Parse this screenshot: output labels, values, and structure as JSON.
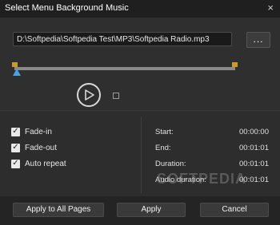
{
  "window": {
    "title": "Select Menu Background Music",
    "close_glyph": "×"
  },
  "file": {
    "path": "D:\\Softpedia\\Softpedia Test\\MP3\\Softpedia Radio.mp3",
    "browse_label": "..."
  },
  "player": {
    "play_icon": "play-icon"
  },
  "options": [
    {
      "label": "Fade-in",
      "checked": true
    },
    {
      "label": "Fade-out",
      "checked": true
    },
    {
      "label": "Auto repeat",
      "checked": true
    }
  ],
  "info": [
    {
      "label": "Start:",
      "value": "00:00:00"
    },
    {
      "label": "End:",
      "value": "00:01:01"
    },
    {
      "label": "Duration:",
      "value": "00:01:01"
    },
    {
      "label": "Audio duration:",
      "value": "00:01:01"
    }
  ],
  "watermark": "SOFTPEDIA",
  "buttons": {
    "apply_all": "Apply to All Pages",
    "apply": "Apply",
    "cancel": "Cancel"
  },
  "colors": {
    "marker": "#c79a2a",
    "playhead": "#4aa3e0"
  }
}
